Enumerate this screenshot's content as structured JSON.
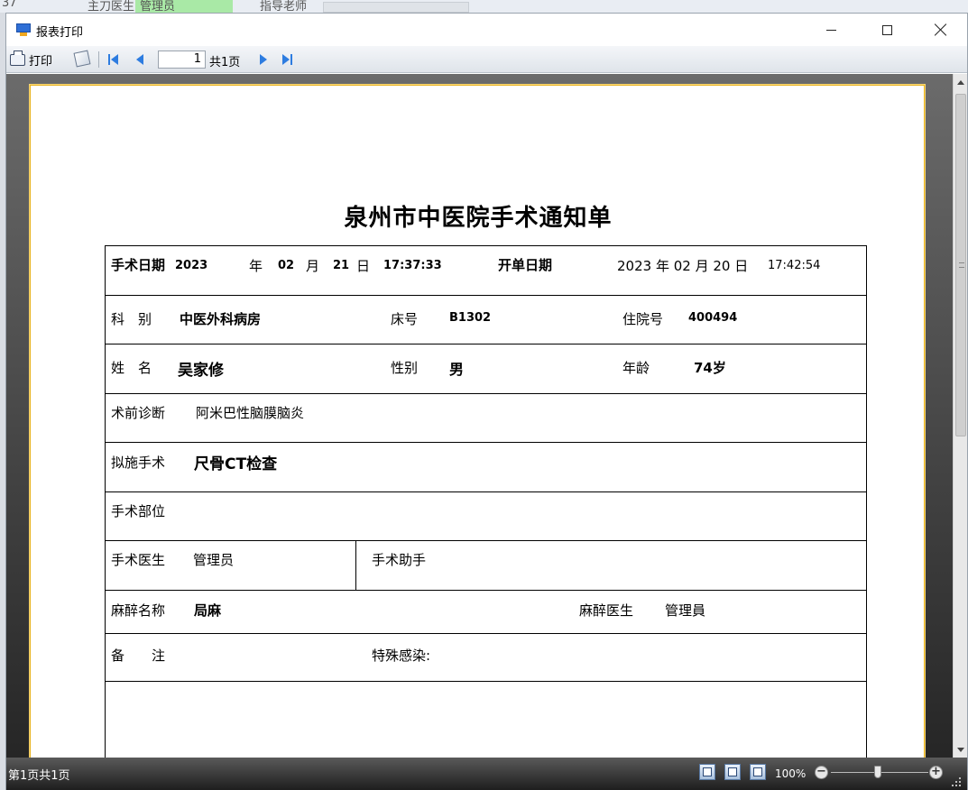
{
  "background_app": {
    "cells": [
      "37",
      "主刀医生",
      "管理员",
      "指导老师"
    ]
  },
  "window": {
    "title": "报表打印"
  },
  "toolbar": {
    "print_label": "打印",
    "current_page": "1",
    "total_pages_label": "共1页"
  },
  "report": {
    "title": "泉州市中医院手术通知单",
    "surgery_date_label": "手术日期",
    "surgery_year": "2023",
    "year_unit": "年",
    "surgery_month": "02",
    "month_unit": "月",
    "surgery_day": "21",
    "day_unit": "日",
    "surgery_time": "17:37:33",
    "order_date_label": "开单日期",
    "order_date_value": "2023 年 02 月 20 日",
    "order_time": "17:42:54",
    "dept_label": "科　别",
    "dept_value": "中医外科病房",
    "bed_label": "床号",
    "bed_value": "B1302",
    "inpatient_label": "住院号",
    "inpatient_value": "400494",
    "name_label": "姓　名",
    "name_value": "吴家修",
    "sex_label": "性别",
    "sex_value": "男",
    "age_label": "年龄",
    "age_value": "74岁",
    "diagnosis_label": "术前诊断",
    "diagnosis_value": "阿米巴性脑膜脑炎",
    "planned_op_label": "拟施手术",
    "planned_op_value": "尺骨CT检查",
    "op_site_label": "手术部位",
    "surgeon_label": "手术医生",
    "surgeon_value": "管理员",
    "assistant_label": "手术助手",
    "anesthesia_label": "麻醉名称",
    "anesthesia_value": "局麻",
    "anesthetist_label": "麻醉医生",
    "anesthetist_value": "管理員",
    "remarks_label": "备　　注",
    "infection_label": "特殊感染:"
  },
  "statusbar": {
    "page_status": "第1页共1页",
    "zoom": "100%"
  },
  "colors": {
    "nav_blue": "#2d7ce0",
    "paper_border": "#e8b21b",
    "bg_green": "#a9e9a6"
  }
}
